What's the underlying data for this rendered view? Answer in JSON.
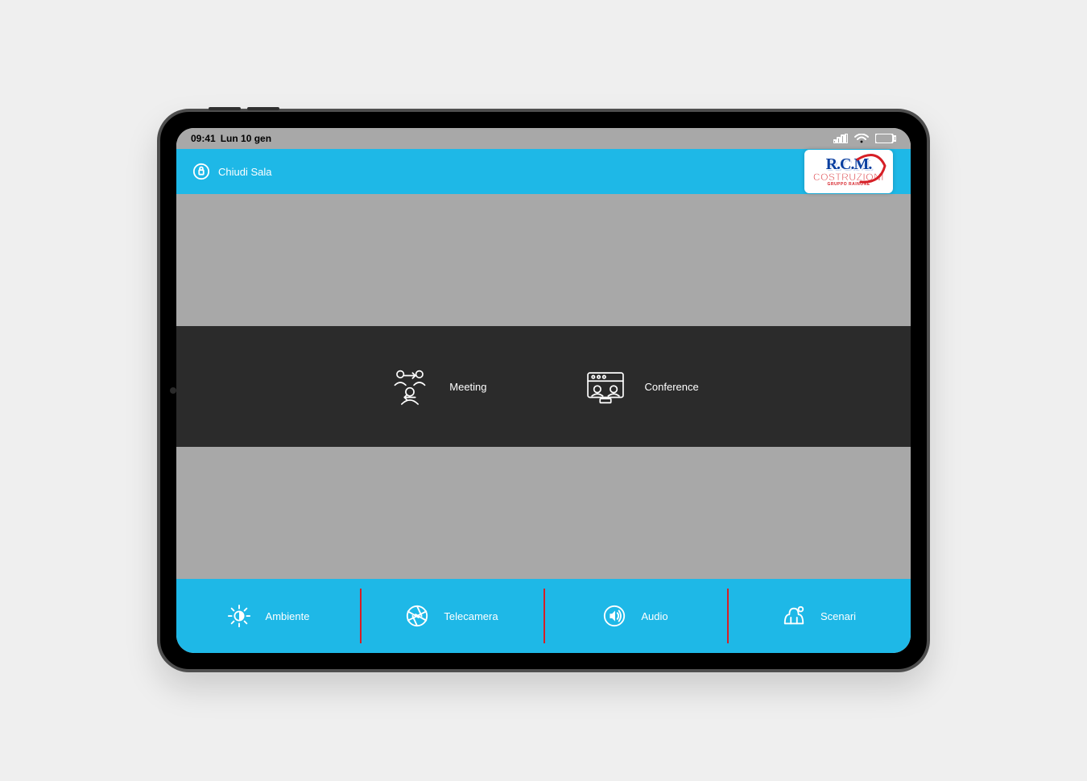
{
  "statusbar": {
    "time": "09:41",
    "date": "Lun 10 gen"
  },
  "topbar": {
    "close_label": "Chiudi Sala"
  },
  "logo": {
    "line1": "R.C.M.",
    "line2": "COSTRUZIONI",
    "line3": "GRUPPO RAINONE"
  },
  "modes": [
    {
      "label": "Meeting",
      "icon": "meeting-icon"
    },
    {
      "label": "Conference",
      "icon": "conference-icon"
    }
  ],
  "nav": [
    {
      "label": "Ambiente",
      "icon": "brightness-icon"
    },
    {
      "label": "Telecamera",
      "icon": "aperture-icon"
    },
    {
      "label": "Audio",
      "icon": "speaker-icon"
    },
    {
      "label": "Scenari",
      "icon": "scene-icon"
    }
  ],
  "colors": {
    "accent": "#1eb8e7",
    "divider": "#d61f26",
    "dark": "#2b2b2b",
    "canvas": "#a8a8a8"
  }
}
